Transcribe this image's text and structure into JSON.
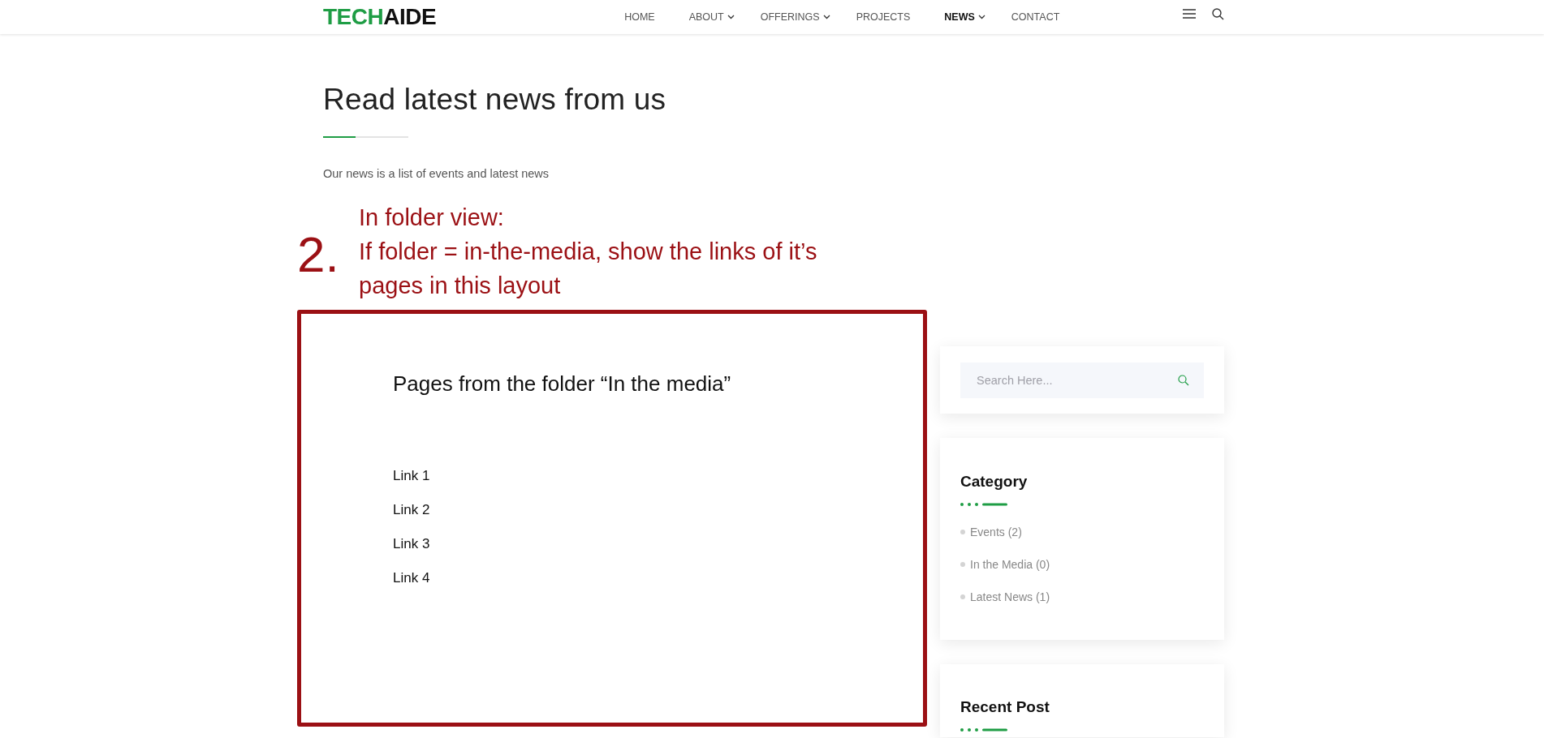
{
  "header": {
    "logo": {
      "part_1": "TECH",
      "part_2": "AIDE"
    },
    "nav": [
      {
        "label": "HOME",
        "selected": false,
        "dropdown": false
      },
      {
        "label": "ABOUT",
        "selected": false,
        "dropdown": true
      },
      {
        "label": "OFFERINGS",
        "selected": false,
        "dropdown": true
      },
      {
        "label": "PROJECTS",
        "selected": false,
        "dropdown": false
      },
      {
        "label": "NEWS",
        "selected": true,
        "dropdown": true
      },
      {
        "label": "CONTACT",
        "selected": false,
        "dropdown": false
      }
    ]
  },
  "page": {
    "title": "Read latest news from us",
    "subtitle": "Our news is a list of events and latest news"
  },
  "annotation": {
    "number": "2.",
    "heading": "In folder view:",
    "body": "If folder = in-the-media, show the links of it’s pages in this layout"
  },
  "mockup": {
    "heading": "Pages from the folder “In the media”",
    "links": [
      "Link 1",
      "Link 2",
      "Link 3",
      "Link 4"
    ]
  },
  "sidebar": {
    "search": {
      "placeholder": "Search Here..."
    },
    "category": {
      "title": "Category",
      "items": [
        {
          "label": "Events",
          "count": "(2)"
        },
        {
          "label": "In the Media",
          "count": "(0)"
        },
        {
          "label": "Latest News",
          "count": "(1)"
        }
      ]
    },
    "recent_post": {
      "title": "Recent Post"
    }
  }
}
